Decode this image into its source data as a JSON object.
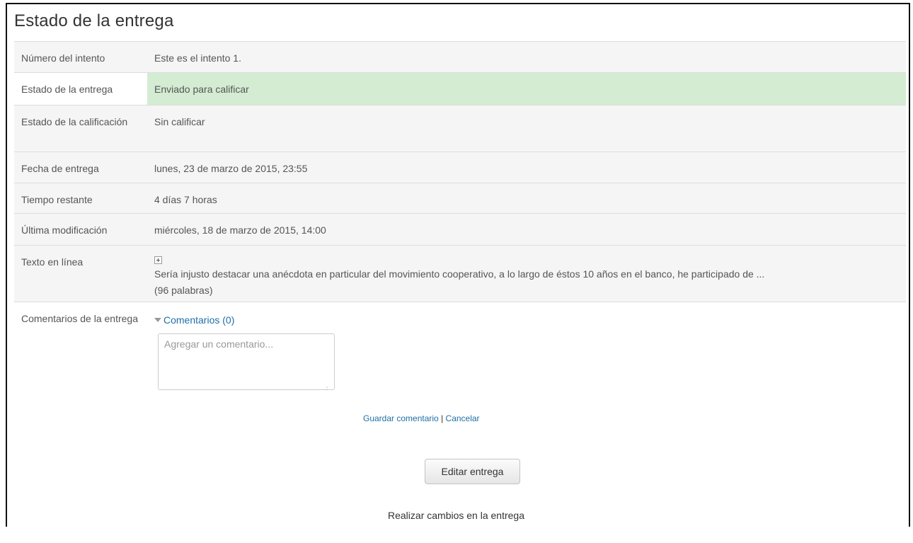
{
  "page_title": "Estado de la entrega",
  "rows": [
    {
      "label": "Número del intento",
      "value": "Este es el intento 1."
    },
    {
      "label": "Estado de la entrega",
      "value": "Enviado para calificar"
    },
    {
      "label": "Estado de la calificación",
      "value": "Sin calificar"
    },
    {
      "label": "Fecha de entrega",
      "value": "lunes, 23 de marzo de 2015, 23:55"
    },
    {
      "label": "Tiempo restante",
      "value": "4 días 7 horas"
    },
    {
      "label": "Última modificación",
      "value": "miércoles, 18 de marzo de 2015, 14:00"
    },
    {
      "label": "Texto en línea",
      "value": "Sería injusto destacar una anécdota en particular del movimiento cooperativo, a lo largo de éstos 10 años en el banco, he participado de ...",
      "word_count": "(96 palabras)"
    },
    {
      "label": "Comentarios de la entrega"
    }
  ],
  "comments": {
    "toggle_label": "Comentarios (0)",
    "placeholder": "Agregar un comentario...",
    "save_label": "Guardar comentario",
    "separator": "|",
    "cancel_label": "Cancelar"
  },
  "edit_button_label": "Editar entrega",
  "edit_help": "Realizar cambios en la entrega",
  "colors": {
    "submitted_bg": "#d3ecd2",
    "link": "#1f6fa6"
  },
  "icons": {
    "expand": "expand-icon",
    "collapse_toggle": "triangle-down-icon"
  }
}
